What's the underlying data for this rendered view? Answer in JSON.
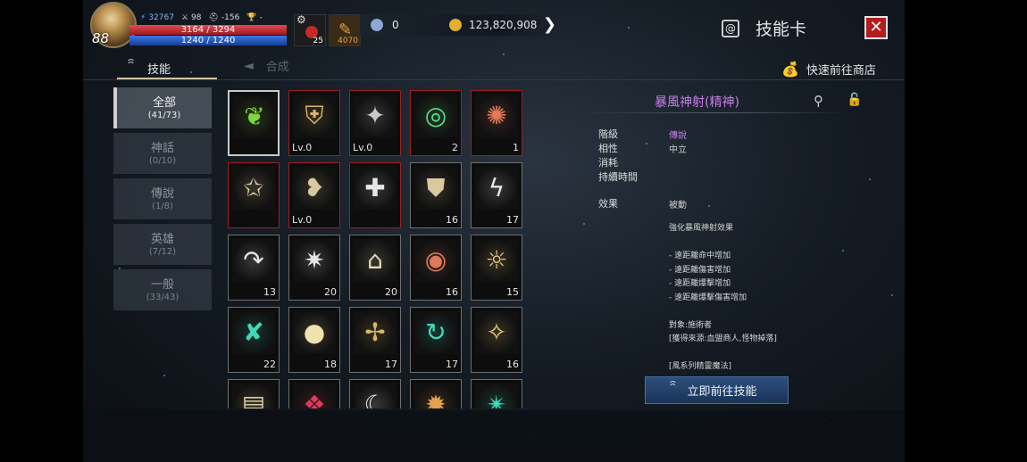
{
  "player": {
    "level": "88",
    "power": "32767",
    "stat2": "98",
    "stat3": "-156",
    "stat4": "-",
    "hp": "3164 / 3294",
    "mp": "1240 / 1240"
  },
  "items": [
    {
      "icon": "potion-icon",
      "count": "25"
    },
    {
      "icon": "feather-icon",
      "count": "4070"
    }
  ],
  "currency": {
    "crystal": "0",
    "gold": "123,820,908"
  },
  "header": {
    "title": "技能卡",
    "close": "✕"
  },
  "tabs": [
    {
      "label": "技能"
    },
    {
      "label": "合成"
    }
  ],
  "shop_link": "快速前往商店",
  "categories": [
    {
      "name": "全部",
      "count": "(41/73)"
    },
    {
      "name": "神話",
      "count": "(0/10)"
    },
    {
      "name": "傳說",
      "count": "(1/8)"
    },
    {
      "name": "英雄",
      "count": "(7/12)"
    },
    {
      "name": "一般",
      "count": "(33/43)"
    }
  ],
  "cards": [
    {
      "label": "",
      "border": "sel",
      "color": "#7fd83a",
      "icon": "leaf-skill-icon"
    },
    {
      "label": "Lv.0",
      "border": "red",
      "color": "#d9b46a",
      "icon": "shield-bow-icon"
    },
    {
      "label": "Lv.0",
      "border": "red",
      "color": "#c9c9c9",
      "icon": "claw-skill-icon"
    },
    {
      "label": "2",
      "border": "red",
      "color": "#5fe08a",
      "icon": "aura-skill-icon"
    },
    {
      "label": "1",
      "border": "red",
      "color": "#e07a5a",
      "icon": "flame-claw-icon"
    },
    {
      "label": "",
      "border": "red",
      "color": "#d9c9a0",
      "icon": "lock-star-icon"
    },
    {
      "label": "Lv.0",
      "border": "red",
      "color": "#d9c9a0",
      "icon": "wing-skill-icon"
    },
    {
      "label": "",
      "border": "red",
      "color": "#e6e6e6",
      "icon": "plus-orb-icon"
    },
    {
      "label": "16",
      "border": "gray",
      "color": "#d9c9a0",
      "icon": "shield-skill-icon"
    },
    {
      "label": "17",
      "border": "gray",
      "color": "#e6e6e6",
      "icon": "lightning-icon"
    },
    {
      "label": "13",
      "border": "gray",
      "color": "#e6e6e6",
      "icon": "arc-arrow-icon"
    },
    {
      "label": "20",
      "border": "gray",
      "color": "#e6e6e6",
      "icon": "burst-icon"
    },
    {
      "label": "20",
      "border": "gray",
      "color": "#e6d9b0",
      "icon": "totem-icon"
    },
    {
      "label": "16",
      "border": "gray",
      "color": "#e07a5a",
      "icon": "eye-skill-icon"
    },
    {
      "label": "15",
      "border": "gray",
      "color": "#e6c680",
      "icon": "spiral-sun-icon"
    },
    {
      "label": "22",
      "border": "gray",
      "color": "#3fd9b8",
      "icon": "arrow-cross-icon"
    },
    {
      "label": "18",
      "border": "gray",
      "color": "#f0e2b0",
      "icon": "orb-skill-icon"
    },
    {
      "label": "17",
      "border": "gray",
      "color": "#d9b46a",
      "icon": "warrior-icon"
    },
    {
      "label": "17",
      "border": "gray",
      "color": "#3fd9b8",
      "icon": "cycle-icon"
    },
    {
      "label": "16",
      "border": "gray",
      "color": "#e6c680",
      "icon": "castle-spark-icon"
    },
    {
      "label": "",
      "border": "gray",
      "color": "#d9c9a0",
      "icon": "scroll-icon"
    },
    {
      "label": "",
      "border": "gray",
      "color": "#e03a5a",
      "icon": "bat-wing-icon"
    },
    {
      "label": "",
      "border": "gray",
      "color": "#e6e6e6",
      "icon": "moon-icon"
    },
    {
      "label": "",
      "border": "gray",
      "color": "#e6a050",
      "icon": "fire-wing-icon"
    },
    {
      "label": "",
      "border": "gray",
      "color": "#3fd9b8",
      "icon": "teal-burst-icon"
    }
  ],
  "detail": {
    "title": "暴風神射(精神)",
    "rows": [
      {
        "label": "階級",
        "value": "傳說",
        "purple": true
      },
      {
        "label": "相性",
        "value": "中立",
        "purple": false
      },
      {
        "label": "消耗",
        "value": "",
        "purple": false
      },
      {
        "label": "持續時間",
        "value": "",
        "purple": false
      }
    ],
    "effect_label": "效果",
    "effect_value": "被動",
    "desc": [
      "強化暴風神射效果",
      "",
      "- 遠距離命中增加",
      "- 遠距離傷害增加",
      "- 遠距離爆擊增加",
      "- 遠距離爆擊傷害增加",
      "",
      "對象:施術者",
      "[獲得來源:血盟商人,怪物掉落]",
      "",
      "[風系列精靈魔法]"
    ],
    "goto_button": "立即前往技能"
  },
  "colors": {
    "accent_purple": "#c77fe8",
    "card_red": "#9b1f22",
    "button_blue": "#2c4f7d",
    "close_red": "#b31d1d"
  }
}
